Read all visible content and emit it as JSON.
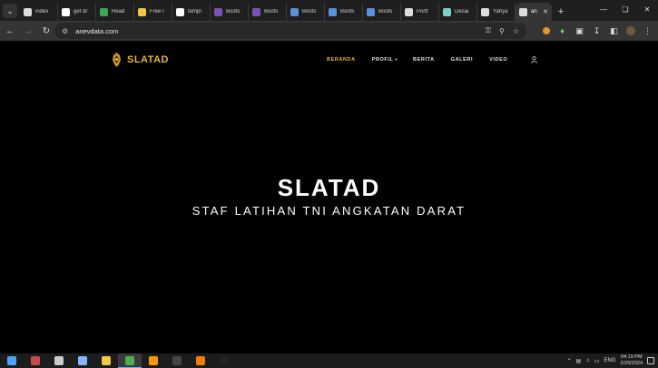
{
  "browser": {
    "tabs": [
      {
        "title": "index",
        "icon": "site-globe-icon",
        "color": "#dddddd"
      },
      {
        "title": "get dr",
        "icon": "google-icon",
        "color": "#ffffff"
      },
      {
        "title": "Read",
        "icon": "read-icon",
        "color": "#3aa757"
      },
      {
        "title": "Free I",
        "icon": "page-icon",
        "color": "#f0c74a"
      },
      {
        "title": "templ",
        "icon": "google-icon",
        "color": "#ffffff"
      },
      {
        "title": "Boots",
        "icon": "bootstrap-icon",
        "color": "#7952b3"
      },
      {
        "title": "Boots",
        "icon": "bootstrap-icon",
        "color": "#7952b3"
      },
      {
        "title": "Boots",
        "icon": "bootstrap-icon",
        "color": "#5b8fd9"
      },
      {
        "title": "Boots",
        "icon": "bootstrap-icon",
        "color": "#5b8fd9"
      },
      {
        "title": "Boots",
        "icon": "bootstrap-icon",
        "color": "#5b8fd9"
      },
      {
        "title": "Portf",
        "icon": "site-globe-icon",
        "color": "#dddddd"
      },
      {
        "title": "Desai",
        "icon": "design-icon",
        "color": "#7ad3c6"
      },
      {
        "title": "Yahya",
        "icon": "site-globe-icon",
        "color": "#dddddd"
      },
      {
        "title": "an",
        "icon": "site-globe-icon",
        "color": "#dddddd",
        "active": true
      }
    ],
    "url": "anevdata.com"
  },
  "site": {
    "brand": "SLATAD",
    "accent": "#e7b53c",
    "menu": {
      "beranda": "BERANDA",
      "profil": "PROFIL",
      "berita": "BERITA",
      "galeri": "GALERI",
      "video": "VIDEO"
    },
    "hero": {
      "title": "SLATAD",
      "subtitle": "STAF LATIHAN TNI ANGKATAN DARAT"
    }
  },
  "taskbar": {
    "apps": [
      {
        "name": "windows-start-icon",
        "color": "#4ca3ff"
      },
      {
        "name": "archive-app-icon",
        "color": "#c94a4a"
      },
      {
        "name": "tool-app-icon",
        "color": "#cccccc"
      },
      {
        "name": "files-app-icon",
        "color": "#8ab4ff"
      },
      {
        "name": "folder-icon",
        "color": "#f0c74a"
      },
      {
        "name": "chrome-icon",
        "color": "#4caf50",
        "active": true
      },
      {
        "name": "sublime-icon",
        "color": "#ff9800"
      },
      {
        "name": "terminal-icon",
        "color": "#444444"
      },
      {
        "name": "xampp-icon",
        "color": "#f57c00"
      },
      {
        "name": "cmd-icon",
        "color": "#222222"
      }
    ],
    "language": "ENG",
    "time": "04:19 PM",
    "date": "2/29/2024"
  }
}
